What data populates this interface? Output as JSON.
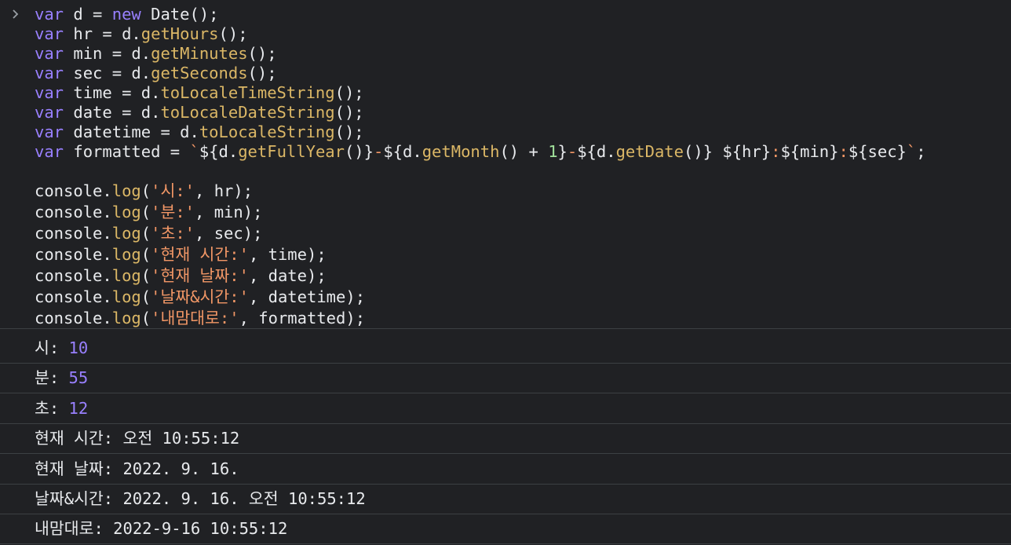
{
  "input": {
    "lines": [
      [
        [
          "kw",
          "var"
        ],
        [
          "plain",
          " d = "
        ],
        [
          "kw",
          "new"
        ],
        [
          "plain",
          " Date();"
        ]
      ],
      [
        [
          "kw",
          "var"
        ],
        [
          "plain",
          " hr = d."
        ],
        [
          "fn",
          "getHours"
        ],
        [
          "plain",
          "();"
        ]
      ],
      [
        [
          "kw",
          "var"
        ],
        [
          "plain",
          " min = d."
        ],
        [
          "fn",
          "getMinutes"
        ],
        [
          "plain",
          "();"
        ]
      ],
      [
        [
          "kw",
          "var"
        ],
        [
          "plain",
          " sec = d."
        ],
        [
          "fn",
          "getSeconds"
        ],
        [
          "plain",
          "();"
        ]
      ],
      [
        [
          "kw",
          "var"
        ],
        [
          "plain",
          " time = d."
        ],
        [
          "fn",
          "toLocaleTimeString"
        ],
        [
          "plain",
          "();"
        ]
      ],
      [
        [
          "kw",
          "var"
        ],
        [
          "plain",
          " date = d."
        ],
        [
          "fn",
          "toLocaleDateString"
        ],
        [
          "plain",
          "();"
        ]
      ],
      [
        [
          "kw",
          "var"
        ],
        [
          "plain",
          " datetime = d."
        ],
        [
          "fn",
          "toLocaleString"
        ],
        [
          "plain",
          "();"
        ]
      ],
      [
        [
          "kw",
          "var"
        ],
        [
          "plain",
          " formatted = "
        ],
        [
          "tpl",
          "`"
        ],
        [
          "plain",
          "${d."
        ],
        [
          "fn",
          "getFullYear"
        ],
        [
          "plain",
          "()}"
        ],
        [
          "tpl",
          "-"
        ],
        [
          "plain",
          "${d."
        ],
        [
          "fn",
          "getMonth"
        ],
        [
          "plain",
          "() + "
        ],
        [
          "num",
          "1"
        ],
        [
          "plain",
          "}"
        ],
        [
          "tpl",
          "-"
        ],
        [
          "plain",
          "${d."
        ],
        [
          "fn",
          "getDate"
        ],
        [
          "plain",
          "()}"
        ],
        [
          "tpl",
          " "
        ],
        [
          "plain",
          "${hr}"
        ],
        [
          "tpl",
          ":"
        ],
        [
          "plain",
          "${min}"
        ],
        [
          "tpl",
          ":"
        ],
        [
          "plain",
          "${sec}"
        ],
        [
          "tpl",
          "`"
        ],
        [
          "plain",
          ";"
        ]
      ],
      [],
      [
        [
          "plain",
          "console."
        ],
        [
          "fn",
          "log"
        ],
        [
          "plain",
          "("
        ],
        [
          "str",
          "'시:'"
        ],
        [
          "plain",
          ", hr);"
        ]
      ],
      [
        [
          "plain",
          "console."
        ],
        [
          "fn",
          "log"
        ],
        [
          "plain",
          "("
        ],
        [
          "str",
          "'분:'"
        ],
        [
          "plain",
          ", min);"
        ]
      ],
      [
        [
          "plain",
          "console."
        ],
        [
          "fn",
          "log"
        ],
        [
          "plain",
          "("
        ],
        [
          "str",
          "'초:'"
        ],
        [
          "plain",
          ", sec);"
        ]
      ],
      [
        [
          "plain",
          "console."
        ],
        [
          "fn",
          "log"
        ],
        [
          "plain",
          "("
        ],
        [
          "str",
          "'현재 시간:'"
        ],
        [
          "plain",
          ", time);"
        ]
      ],
      [
        [
          "plain",
          "console."
        ],
        [
          "fn",
          "log"
        ],
        [
          "plain",
          "("
        ],
        [
          "str",
          "'현재 날짜:'"
        ],
        [
          "plain",
          ", date);"
        ]
      ],
      [
        [
          "plain",
          "console."
        ],
        [
          "fn",
          "log"
        ],
        [
          "plain",
          "("
        ],
        [
          "str",
          "'날짜&시간:'"
        ],
        [
          "plain",
          ", datetime);"
        ]
      ],
      [
        [
          "plain",
          "console."
        ],
        [
          "fn",
          "log"
        ],
        [
          "plain",
          "("
        ],
        [
          "str",
          "'내맘대로:'"
        ],
        [
          "plain",
          ", formatted);"
        ]
      ]
    ]
  },
  "outputs": [
    {
      "label": "시:",
      "value": "10",
      "numeric": true
    },
    {
      "label": "분:",
      "value": "55",
      "numeric": true
    },
    {
      "label": "초:",
      "value": "12",
      "numeric": true
    },
    {
      "label": "현재 시간:",
      "value": "오전 10:55:12",
      "numeric": false
    },
    {
      "label": "현재 날짜:",
      "value": "2022. 9. 16.",
      "numeric": false
    },
    {
      "label": "날짜&시간:",
      "value": "2022. 9. 16. 오전 10:55:12",
      "numeric": false
    },
    {
      "label": "내맘대로:",
      "value": "2022-9-16 10:55:12",
      "numeric": false
    }
  ]
}
